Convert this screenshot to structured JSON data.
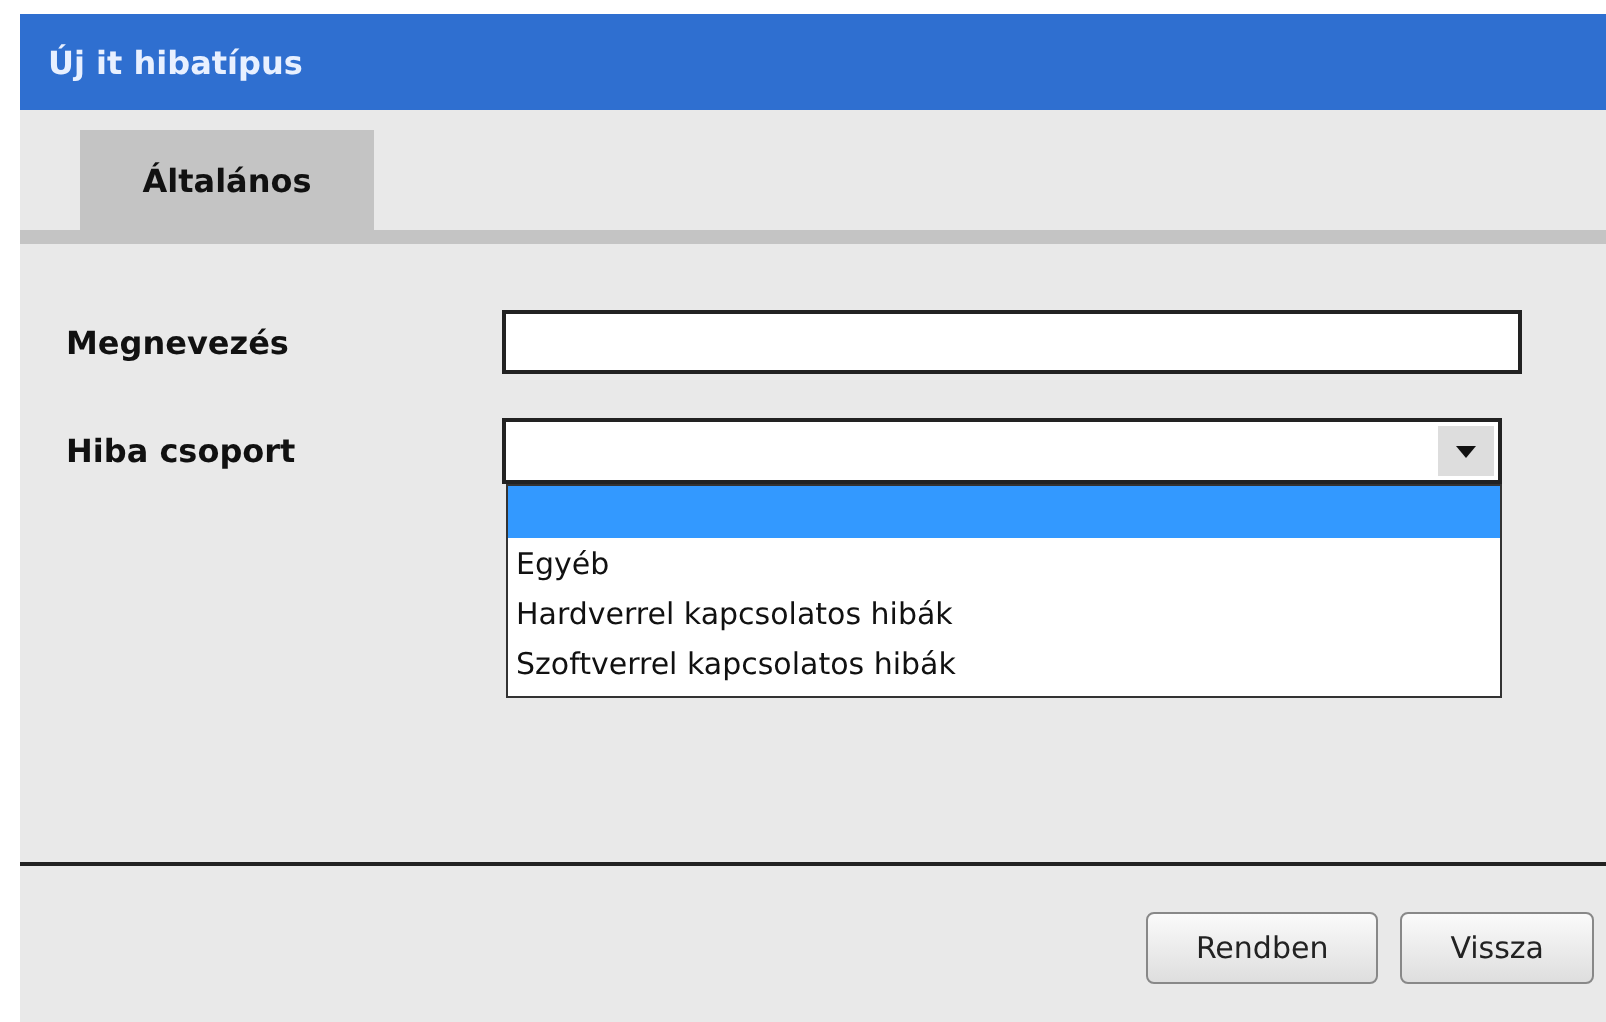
{
  "window": {
    "title": "Új it hibatípus"
  },
  "tabs": [
    {
      "label": "Általános",
      "selected": true
    }
  ],
  "fields": [
    {
      "kind": "text",
      "label": "Megnevezés"
    },
    {
      "kind": "select",
      "label": "Hiba csoport",
      "expanded": true,
      "options": [
        {
          "selected": true
        },
        {
          "label": "Egyéb",
          "selected": false
        },
        {
          "label": "Hardverrel kapcsolatos hibák",
          "selected": false
        },
        {
          "label": "Szoftverrel kapcsolatos hibák",
          "selected": false
        }
      ]
    }
  ],
  "buttons": [
    "Rendben",
    "Vissza"
  ]
}
